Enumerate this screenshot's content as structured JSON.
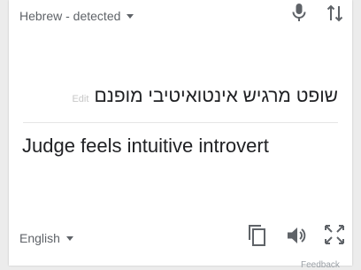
{
  "source": {
    "language_label": "Hebrew - detected",
    "edit_label": "Edit",
    "text": "שופט מרגיש אינטואיטיבי מופנם"
  },
  "target": {
    "language_label": "English",
    "translation": "Judge feels intuitive introvert"
  },
  "footer": {
    "feedback_label": "Feedback"
  },
  "icons": {
    "mic": "microphone-icon",
    "swap": "swap-languages-icon",
    "copy": "copy-icon",
    "speaker": "speaker-icon",
    "fullscreen": "fullscreen-icon"
  },
  "colors": {
    "icon": "#5f6368",
    "text": "#202124",
    "muted": "#c7c7c7"
  }
}
